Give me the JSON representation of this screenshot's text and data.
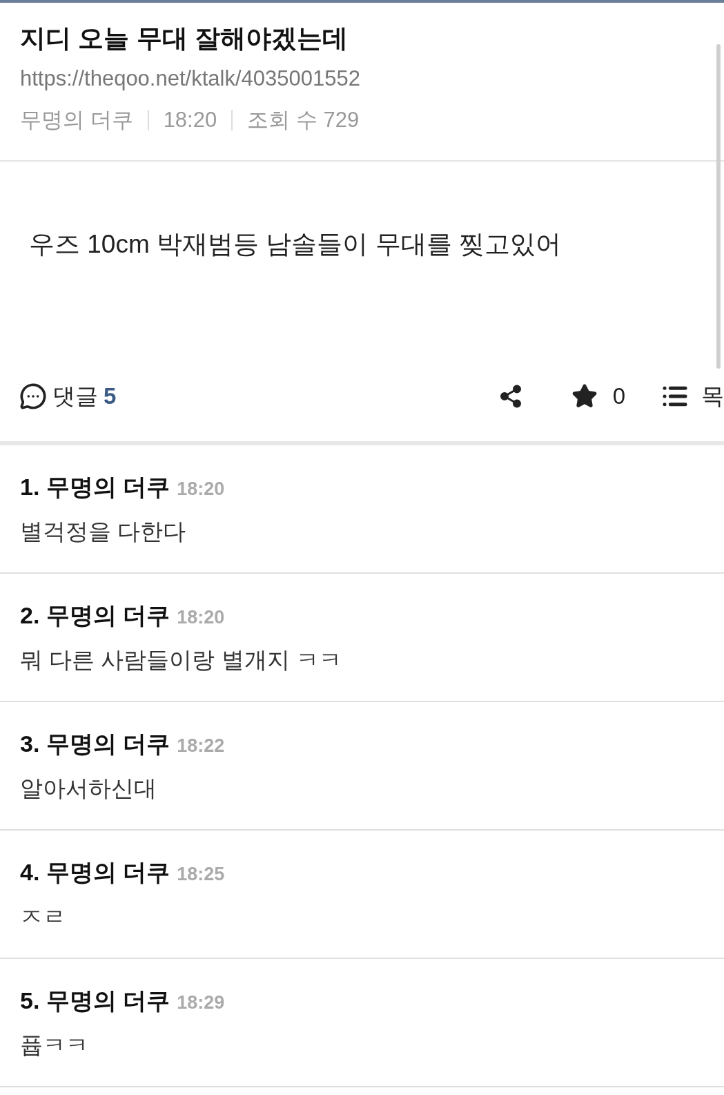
{
  "post": {
    "title": "지디 오늘 무대 잘해야겠는데",
    "url": "https://theqoo.net/ktalk/4035001552",
    "author": "무명의 더쿠",
    "time": "18:20",
    "views": "조회 수 729"
  },
  "body": "우즈 10cm 박재범등 남솔들이 무대를 찢고있어",
  "toolbar": {
    "comments_label": "댓글",
    "comment_count": "5",
    "star_count": "0",
    "list_label": "목"
  },
  "comments": [
    {
      "number": "1.",
      "author": "무명의 더쿠",
      "time": "18:20",
      "text": "별걱정을 다한다"
    },
    {
      "number": "2.",
      "author": "무명의 더쿠",
      "time": "18:20",
      "text": "뭐 다른 사람들이랑 별개지 ㅋㅋ"
    },
    {
      "number": "3.",
      "author": "무명의 더쿠",
      "time": "18:22",
      "text": "알아서하신대"
    },
    {
      "number": "4.",
      "author": "무명의 더쿠",
      "time": "18:25",
      "text": "ㅈㄹ"
    },
    {
      "number": "5.",
      "author": "무명의 더쿠",
      "time": "18:29",
      "text": "퓹ㅋㅋ"
    }
  ]
}
